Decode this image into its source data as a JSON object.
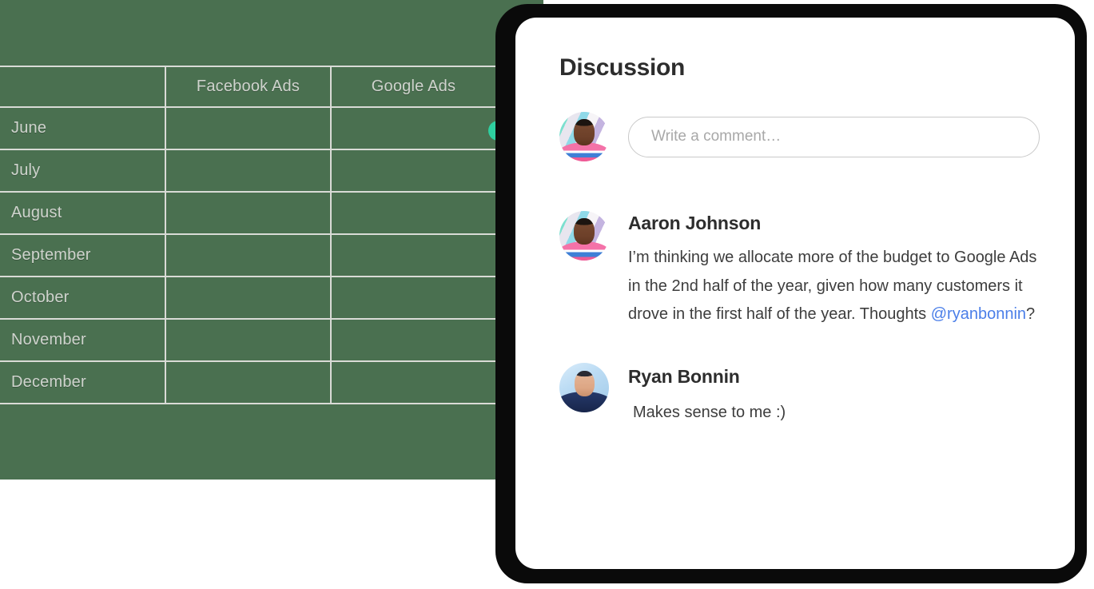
{
  "colors": {
    "sheet_background": "#4a7050",
    "grid_line": "#d9dbd6",
    "sheet_text": "#cfd3cd",
    "cursor_dot": "#2ecfa0",
    "panel_background": "#ffffff",
    "bezel": "#0a0a0a",
    "mention_link": "#4a7ee8",
    "heading_text": "#2d2d2d",
    "body_text": "#3d3d3d",
    "placeholder_text": "#a8a8a8",
    "input_border": "#c9c9c9"
  },
  "spreadsheet": {
    "columns": [
      "",
      "Facebook Ads",
      "Google Ads",
      ""
    ],
    "rows": [
      {
        "month": "June",
        "facebook_ads": "",
        "google_ads": "",
        "extra": ""
      },
      {
        "month": "July",
        "facebook_ads": "",
        "google_ads": "",
        "extra": ""
      },
      {
        "month": "August",
        "facebook_ads": "",
        "google_ads": "",
        "extra": ""
      },
      {
        "month": "September",
        "facebook_ads": "",
        "google_ads": "",
        "extra": ""
      },
      {
        "month": "October",
        "facebook_ads": "",
        "google_ads": "",
        "extra": ""
      },
      {
        "month": "November",
        "facebook_ads": "",
        "google_ads": "",
        "extra": ""
      },
      {
        "month": "December",
        "facebook_ads": "",
        "google_ads": "",
        "extra": ""
      }
    ],
    "cursor": {
      "icon": "presence-cursor-dot"
    }
  },
  "panel": {
    "title": "Discussion",
    "composer": {
      "avatar_icon": "avatar-aaron-johnson",
      "placeholder": "Write a comment…",
      "value": ""
    },
    "comments": [
      {
        "avatar_icon": "avatar-aaron-johnson",
        "author": "Aaron Johnson",
        "text_before_mention": "I’m thinking we allocate more of the budget to Google Ads in the 2nd half of the year, given how many customers it drove in the first half of the year. Thoughts ",
        "mention": "@ryanbonnin",
        "text_after_mention": "?"
      },
      {
        "avatar_icon": "avatar-ryan-bonnin",
        "author": "Ryan Bonnin",
        "text": "Makes sense to me :)"
      }
    ]
  }
}
